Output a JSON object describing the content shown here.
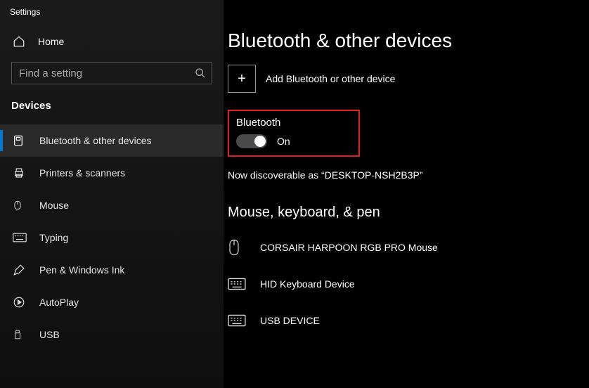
{
  "title": "Settings",
  "home_label": "Home",
  "search": {
    "placeholder": "Find a setting"
  },
  "section_title": "Devices",
  "nav": [
    {
      "label": "Bluetooth & other devices",
      "icon": "bluetooth-icon",
      "active": true
    },
    {
      "label": "Printers & scanners",
      "icon": "printer-icon",
      "active": false
    },
    {
      "label": "Mouse",
      "icon": "mouse-icon",
      "active": false
    },
    {
      "label": "Typing",
      "icon": "keyboard-icon",
      "active": false
    },
    {
      "label": "Pen & Windows Ink",
      "icon": "pen-icon",
      "active": false
    },
    {
      "label": "AutoPlay",
      "icon": "autoplay-icon",
      "active": false
    },
    {
      "label": "USB",
      "icon": "usb-icon",
      "active": false
    }
  ],
  "page_heading": "Bluetooth & other devices",
  "add_label": "Add Bluetooth or other device",
  "bluetooth": {
    "label": "Bluetooth",
    "state_label": "On"
  },
  "discoverable_text": "Now discoverable as “DESKTOP-NSH2B3P”",
  "devices_heading": "Mouse, keyboard, & pen",
  "devices": [
    {
      "name": "CORSAIR HARPOON RGB PRO Mouse",
      "icon": "mouse-icon"
    },
    {
      "name": "HID Keyboard Device",
      "icon": "keyboard-icon"
    },
    {
      "name": "USB DEVICE",
      "icon": "keyboard-icon"
    }
  ]
}
